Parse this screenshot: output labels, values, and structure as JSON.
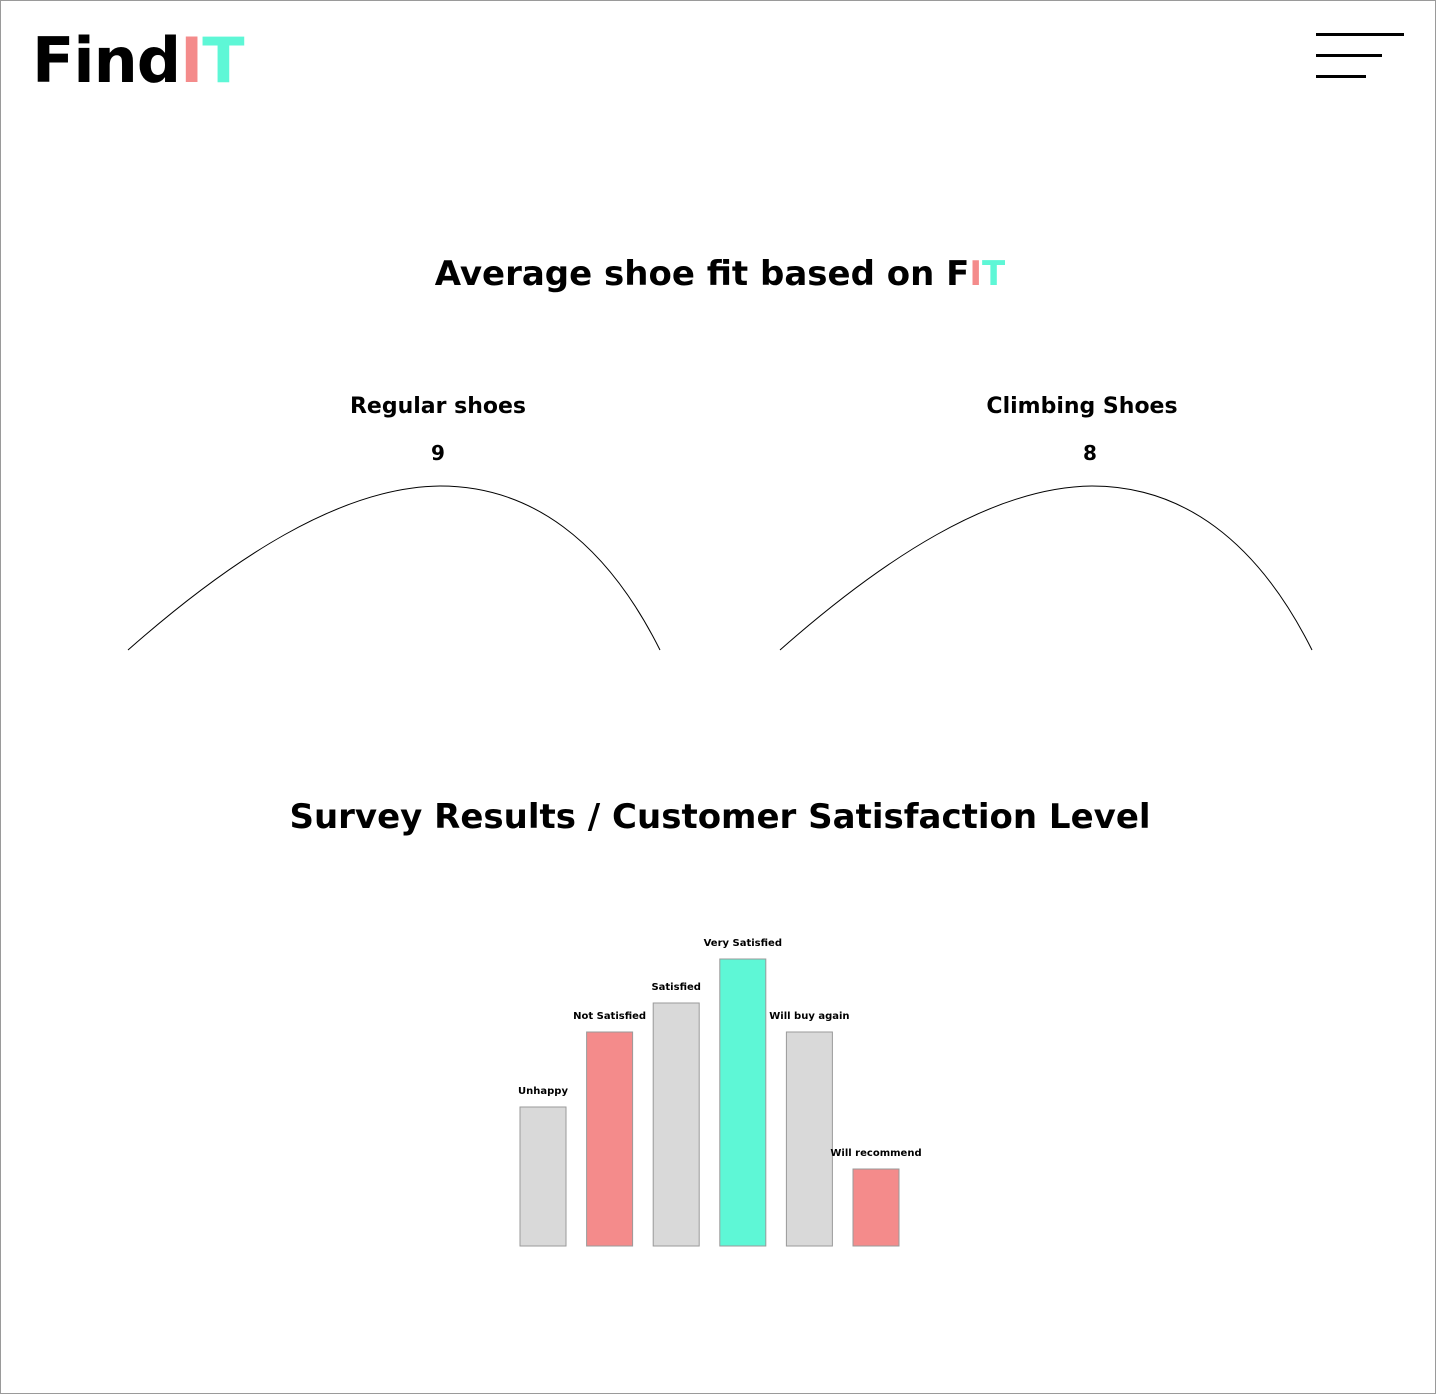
{
  "header": {
    "logo_find": "Find",
    "logo_i": "I",
    "logo_t": "T",
    "menu_icon": "hamburger-menu-icon"
  },
  "fit_section": {
    "title_main": "Average shoe fit based on F",
    "title_i": "I",
    "title_t": "T",
    "gauges": [
      {
        "label": "Regular shoes",
        "value": "9"
      },
      {
        "label": "Climbing Shoes",
        "value": "8"
      }
    ]
  },
  "survey_section": {
    "title": "Survey Results / Customer Satisfaction Level"
  },
  "colors": {
    "accent_pink": "#f48b8b",
    "accent_teal": "#5ef7d6",
    "bar_gray": "#d9d9d9",
    "text": "#000000"
  },
  "chart_data": {
    "type": "bar",
    "title": "",
    "xlabel": "",
    "ylabel": "",
    "categories": [
      "Unhappy",
      "Not Satisfied",
      "Satisfied",
      "Very Satisfied",
      "Will buy again",
      "Will recommend"
    ],
    "values": [
      139,
      214,
      243,
      287,
      214,
      77
    ],
    "bar_colors": [
      "#d9d9d9",
      "#f48b8b",
      "#d9d9d9",
      "#5ef7d6",
      "#d9d9d9",
      "#f48b8b"
    ],
    "ylim": [
      0,
      300
    ],
    "grid": false,
    "legend": "none"
  }
}
